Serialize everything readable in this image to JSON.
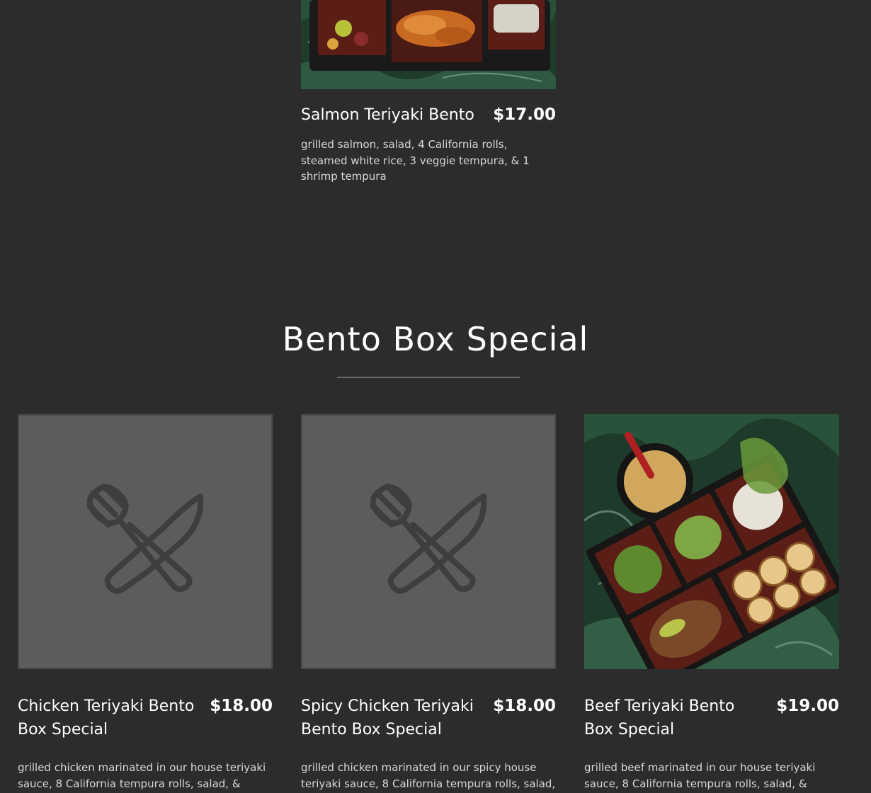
{
  "top_item": {
    "name": "Salmon Teriyaki Bento",
    "price": "$17.00",
    "description": "grilled salmon, salad, 4 California rolls, steamed white rice, 3 veggie tempura, & 1 shrimp tempura",
    "image": "salmon-bento-photo"
  },
  "section": {
    "title": "Bento Box Special"
  },
  "items": [
    {
      "name": "Chicken Teriyaki Bento Box Special",
      "price": "$18.00",
      "description": "grilled chicken marinated in our house teriyaki sauce, 8 California tempura rolls, salad, & steamed white rice",
      "image": "fork-knife-placeholder-icon"
    },
    {
      "name": "Spicy Chicken Teriyaki Bento Box Special",
      "price": "$18.00",
      "description": "grilled chicken marinated in our spicy house teriyaki sauce, 8 California tempura rolls, salad, & steamed white rice",
      "image": "fork-knife-placeholder-icon"
    },
    {
      "name": "Beef Teriyaki Bento Box Special",
      "price": "$19.00",
      "description": "grilled beef marinated in our house teriyaki sauce, 8 California tempura rolls, salad, & steamed white rice",
      "image": "beef-bento-photo"
    }
  ],
  "colors": {
    "background": "#2c2c2c",
    "text": "#ffffff",
    "muted_text": "#d8d8d8",
    "placeholder": "#5c5c5c",
    "rule": "#6b6b6b"
  }
}
